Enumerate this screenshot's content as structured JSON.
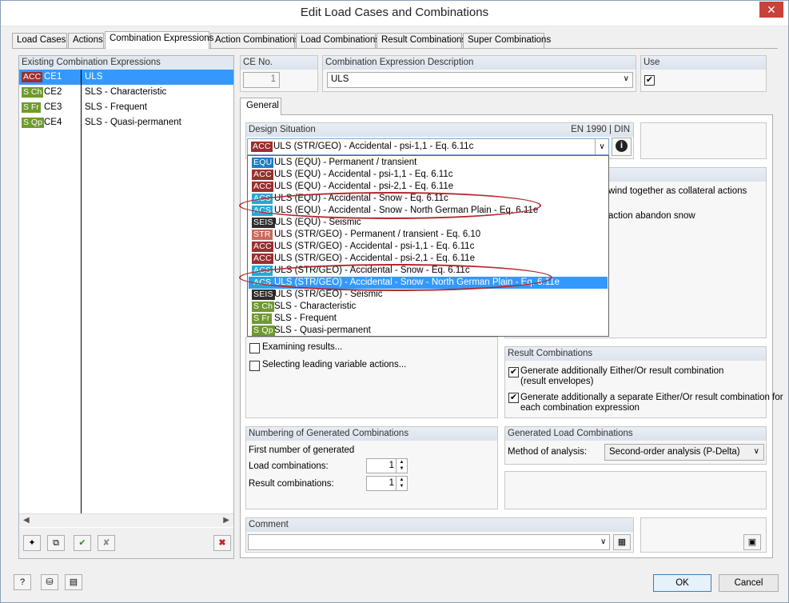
{
  "window": {
    "title": "Edit Load Cases and Combinations",
    "close": "✕"
  },
  "tabs": [
    "Load Cases",
    "Actions",
    "Combination Expressions",
    "Action Combinations",
    "Load Combinations",
    "Result Combinations",
    "Super Combinations"
  ],
  "colors": {
    "ACC": "#9b2f2f",
    "EQU": "#1e7bc4",
    "ACS": "#29a6d9",
    "SEIS": "#2e2e2e",
    "STR": "#c96a5e",
    "SLS": "#6f9a2f",
    "selection": "#3399ff",
    "highlight_ring": "#b3262e"
  },
  "existing": {
    "header": "Existing Combination Expressions",
    "rows": [
      {
        "code": "ACC",
        "id": "CE1",
        "desc": "ULS"
      },
      {
        "code": "S Ch",
        "id": "CE2",
        "desc": "SLS - Characteristic"
      },
      {
        "code": "S Fr",
        "id": "CE3",
        "desc": "SLS - Frequent"
      },
      {
        "code": "S Qp",
        "id": "CE4",
        "desc": "SLS - Quasi-permanent"
      }
    ]
  },
  "ce_no": {
    "label": "CE No.",
    "value": "1"
  },
  "description": {
    "label": "Combination Expression Description",
    "value": "ULS"
  },
  "use": {
    "label": "Use"
  },
  "general_tab": "General",
  "design_situation": {
    "label": "Design Situation",
    "standard": "EN 1990 | DIN",
    "selected_code": "ACC",
    "selected": "ULS (STR/GEO) - Accidental - psi-1,1 - Eq. 6.11c",
    "options": [
      {
        "code": "EQU",
        "label": "ULS (EQU) - Permanent / transient"
      },
      {
        "code": "ACC",
        "label": "ULS (EQU) - Accidental - psi-1,1 - Eq. 6.11c"
      },
      {
        "code": "ACC",
        "label": "ULS (EQU) - Accidental - psi-2,1 - Eq. 6.11e"
      },
      {
        "code": "ACS",
        "label": "ULS (EQU) - Accidental - Snow - Eq. 6.11c"
      },
      {
        "code": "ACS",
        "label": "ULS (EQU) - Accidental - Snow - North German Plain - Eq. 6.11e"
      },
      {
        "code": "SEIS",
        "label": "ULS (EQU) - Seismic"
      },
      {
        "code": "STR",
        "label": "ULS (STR/GEO) - Permanent / transient - Eq. 6.10"
      },
      {
        "code": "ACC",
        "label": "ULS (STR/GEO) - Accidental - psi-1,1 - Eq. 6.11c"
      },
      {
        "code": "ACC",
        "label": "ULS (STR/GEO) - Accidental - psi-2,1 - Eq. 6.11e"
      },
      {
        "code": "ACS",
        "label": "ULS (STR/GEO) - Accidental - Snow - Eq. 6.11c"
      },
      {
        "code": "ACS",
        "label": "ULS (STR/GEO) - Accidental - Snow - North German Plain - Eq. 6.11e"
      },
      {
        "code": "SEIS",
        "label": "ULS (STR/GEO) - Seismic"
      },
      {
        "code": "S Ch",
        "label": "SLS - Characteristic"
      },
      {
        "code": "S Fr",
        "label": "SLS - Frequent"
      },
      {
        "code": "S Qp",
        "label": "SLS - Quasi-permanent"
      }
    ]
  },
  "partial_text": {
    "line1": "wind together as collateral actions",
    "line2": "action abandon snow"
  },
  "options": {
    "examining": "Examining results...",
    "selecting": "Selecting leading variable actions..."
  },
  "result_combinations": {
    "header": "Result Combinations",
    "opt1_line1": "Generate additionally Either/Or result combination",
    "opt1_line2": "(result envelopes)",
    "opt2_line1": "Generate additionally a separate Either/Or result combination for",
    "opt2_line2": "each combination expression"
  },
  "numbering": {
    "header": "Numbering of Generated Combinations",
    "first": "First number of generated",
    "load_label": "Load combinations:",
    "load_value": "1",
    "result_label": "Result combinations:",
    "result_value": "1"
  },
  "generated": {
    "header": "Generated Load Combinations",
    "method_label": "Method of analysis:",
    "method_value": "Second-order analysis (P-Delta)"
  },
  "comment": {
    "label": "Comment",
    "value": ""
  },
  "buttons": {
    "ok": "OK",
    "cancel": "Cancel"
  }
}
